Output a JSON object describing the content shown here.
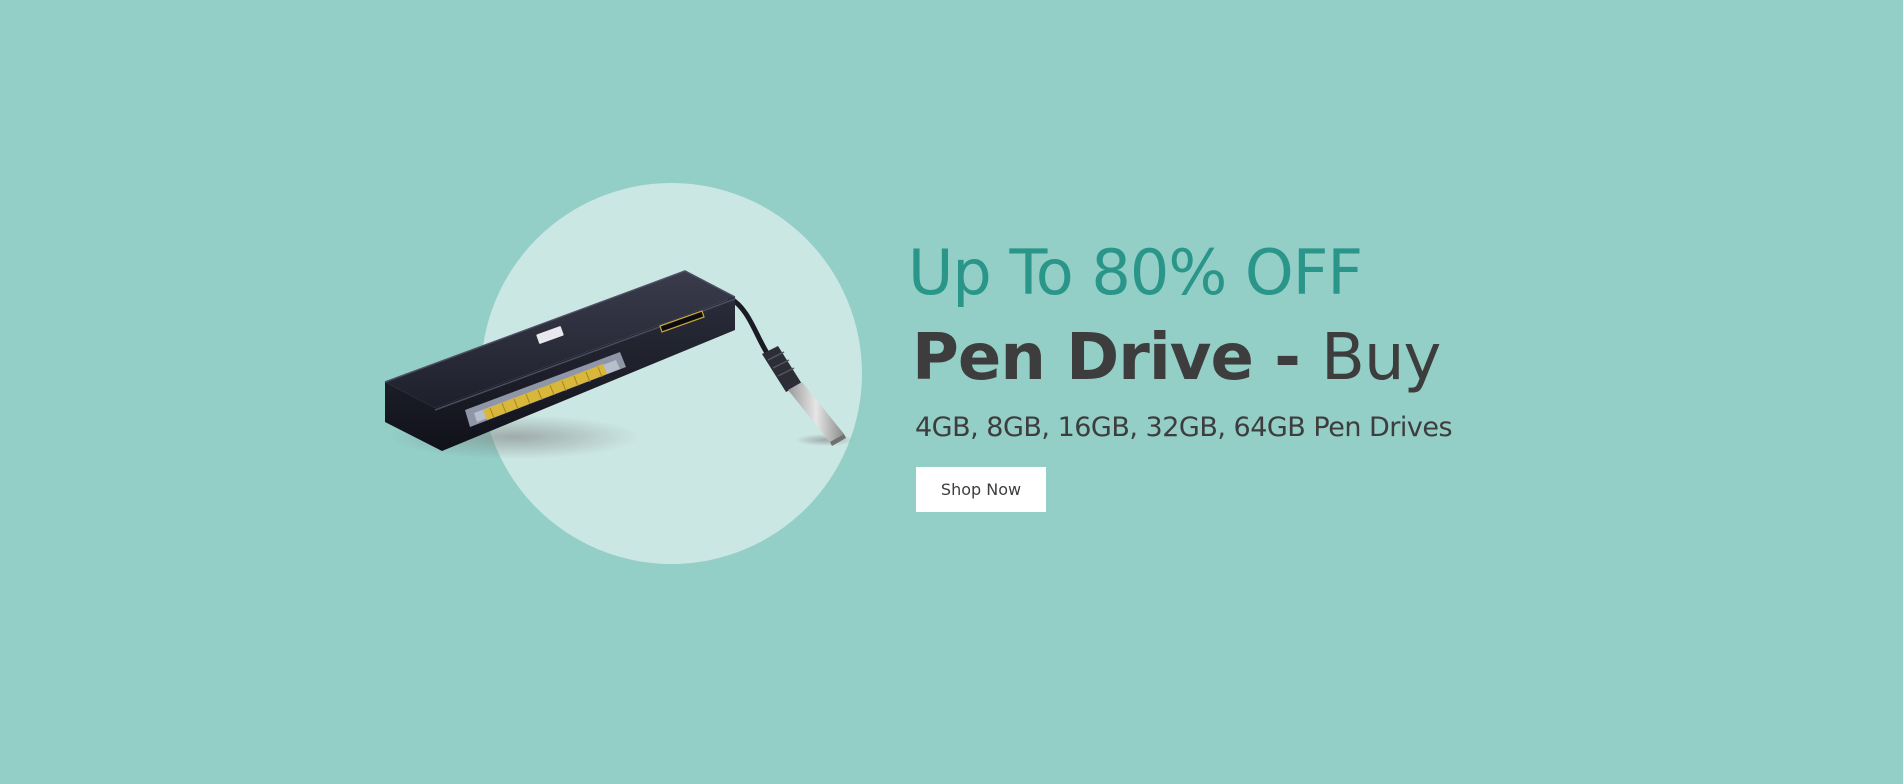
{
  "banner": {
    "discount_text": "Up To 80% OFF",
    "headline_bold": "Pen Drive - ",
    "headline_light": "Buy",
    "subheadline": "4GB, 8GB, 16GB, 32GB, 64GB Pen Drives",
    "cta_label": "Shop Now",
    "product_image": "card-reader-usb-device",
    "colors": {
      "background": "#93cec7",
      "circle": "#cbe7e3",
      "accent": "#2a968a",
      "text": "#3d3d3d",
      "button_bg": "#ffffff"
    }
  }
}
